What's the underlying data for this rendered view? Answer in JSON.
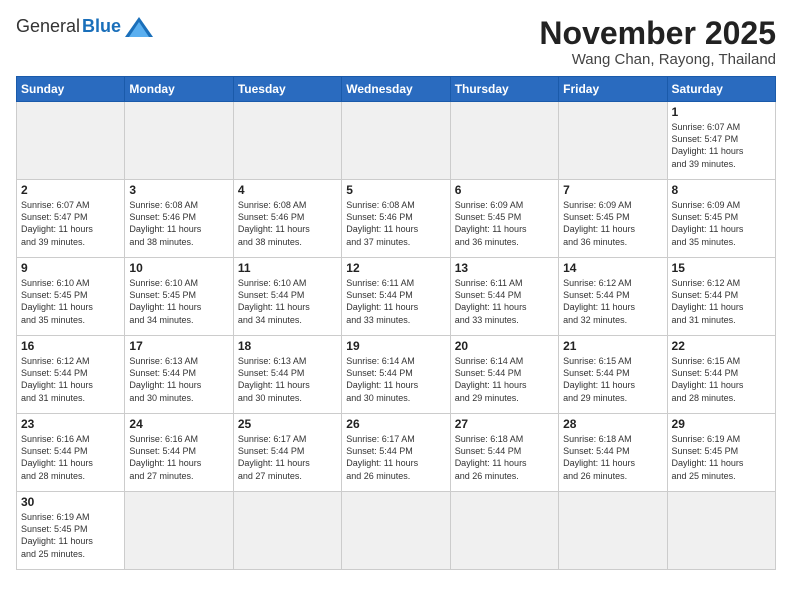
{
  "logo": {
    "general": "General",
    "blue": "Blue"
  },
  "title": {
    "month": "November 2025",
    "location": "Wang Chan, Rayong, Thailand"
  },
  "weekdays": [
    "Sunday",
    "Monday",
    "Tuesday",
    "Wednesday",
    "Thursday",
    "Friday",
    "Saturday"
  ],
  "days": [
    {
      "num": "",
      "empty": true
    },
    {
      "num": "",
      "empty": true
    },
    {
      "num": "",
      "empty": true
    },
    {
      "num": "",
      "empty": true
    },
    {
      "num": "",
      "empty": true
    },
    {
      "num": "",
      "empty": true
    },
    {
      "num": "1",
      "sunrise": "6:07 AM",
      "sunset": "5:47 PM",
      "daylight": "11 hours and 39 minutes."
    },
    {
      "num": "2",
      "sunrise": "6:07 AM",
      "sunset": "5:47 PM",
      "daylight": "11 hours and 39 minutes."
    },
    {
      "num": "3",
      "sunrise": "6:08 AM",
      "sunset": "5:46 PM",
      "daylight": "11 hours and 38 minutes."
    },
    {
      "num": "4",
      "sunrise": "6:08 AM",
      "sunset": "5:46 PM",
      "daylight": "11 hours and 38 minutes."
    },
    {
      "num": "5",
      "sunrise": "6:08 AM",
      "sunset": "5:46 PM",
      "daylight": "11 hours and 37 minutes."
    },
    {
      "num": "6",
      "sunrise": "6:09 AM",
      "sunset": "5:45 PM",
      "daylight": "11 hours and 36 minutes."
    },
    {
      "num": "7",
      "sunrise": "6:09 AM",
      "sunset": "5:45 PM",
      "daylight": "11 hours and 36 minutes."
    },
    {
      "num": "8",
      "sunrise": "6:09 AM",
      "sunset": "5:45 PM",
      "daylight": "11 hours and 35 minutes."
    },
    {
      "num": "9",
      "sunrise": "6:10 AM",
      "sunset": "5:45 PM",
      "daylight": "11 hours and 35 minutes."
    },
    {
      "num": "10",
      "sunrise": "6:10 AM",
      "sunset": "5:45 PM",
      "daylight": "11 hours and 34 minutes."
    },
    {
      "num": "11",
      "sunrise": "6:10 AM",
      "sunset": "5:44 PM",
      "daylight": "11 hours and 34 minutes."
    },
    {
      "num": "12",
      "sunrise": "6:11 AM",
      "sunset": "5:44 PM",
      "daylight": "11 hours and 33 minutes."
    },
    {
      "num": "13",
      "sunrise": "6:11 AM",
      "sunset": "5:44 PM",
      "daylight": "11 hours and 33 minutes."
    },
    {
      "num": "14",
      "sunrise": "6:12 AM",
      "sunset": "5:44 PM",
      "daylight": "11 hours and 32 minutes."
    },
    {
      "num": "15",
      "sunrise": "6:12 AM",
      "sunset": "5:44 PM",
      "daylight": "11 hours and 31 minutes."
    },
    {
      "num": "16",
      "sunrise": "6:12 AM",
      "sunset": "5:44 PM",
      "daylight": "11 hours and 31 minutes."
    },
    {
      "num": "17",
      "sunrise": "6:13 AM",
      "sunset": "5:44 PM",
      "daylight": "11 hours and 30 minutes."
    },
    {
      "num": "18",
      "sunrise": "6:13 AM",
      "sunset": "5:44 PM",
      "daylight": "11 hours and 30 minutes."
    },
    {
      "num": "19",
      "sunrise": "6:14 AM",
      "sunset": "5:44 PM",
      "daylight": "11 hours and 30 minutes."
    },
    {
      "num": "20",
      "sunrise": "6:14 AM",
      "sunset": "5:44 PM",
      "daylight": "11 hours and 29 minutes."
    },
    {
      "num": "21",
      "sunrise": "6:15 AM",
      "sunset": "5:44 PM",
      "daylight": "11 hours and 29 minutes."
    },
    {
      "num": "22",
      "sunrise": "6:15 AM",
      "sunset": "5:44 PM",
      "daylight": "11 hours and 28 minutes."
    },
    {
      "num": "23",
      "sunrise": "6:16 AM",
      "sunset": "5:44 PM",
      "daylight": "11 hours and 28 minutes."
    },
    {
      "num": "24",
      "sunrise": "6:16 AM",
      "sunset": "5:44 PM",
      "daylight": "11 hours and 27 minutes."
    },
    {
      "num": "25",
      "sunrise": "6:17 AM",
      "sunset": "5:44 PM",
      "daylight": "11 hours and 27 minutes."
    },
    {
      "num": "26",
      "sunrise": "6:17 AM",
      "sunset": "5:44 PM",
      "daylight": "11 hours and 26 minutes."
    },
    {
      "num": "27",
      "sunrise": "6:18 AM",
      "sunset": "5:44 PM",
      "daylight": "11 hours and 26 minutes."
    },
    {
      "num": "28",
      "sunrise": "6:18 AM",
      "sunset": "5:44 PM",
      "daylight": "11 hours and 26 minutes."
    },
    {
      "num": "29",
      "sunrise": "6:19 AM",
      "sunset": "5:45 PM",
      "daylight": "11 hours and 25 minutes."
    },
    {
      "num": "30",
      "sunrise": "6:19 AM",
      "sunset": "5:45 PM",
      "daylight": "11 hours and 25 minutes."
    },
    {
      "num": "",
      "empty": true
    },
    {
      "num": "",
      "empty": true
    },
    {
      "num": "",
      "empty": true
    },
    {
      "num": "",
      "empty": true
    },
    {
      "num": "",
      "empty": true
    },
    {
      "num": "",
      "empty": true
    }
  ],
  "labels": {
    "sunrise": "Sunrise:",
    "sunset": "Sunset:",
    "daylight": "Daylight:"
  }
}
